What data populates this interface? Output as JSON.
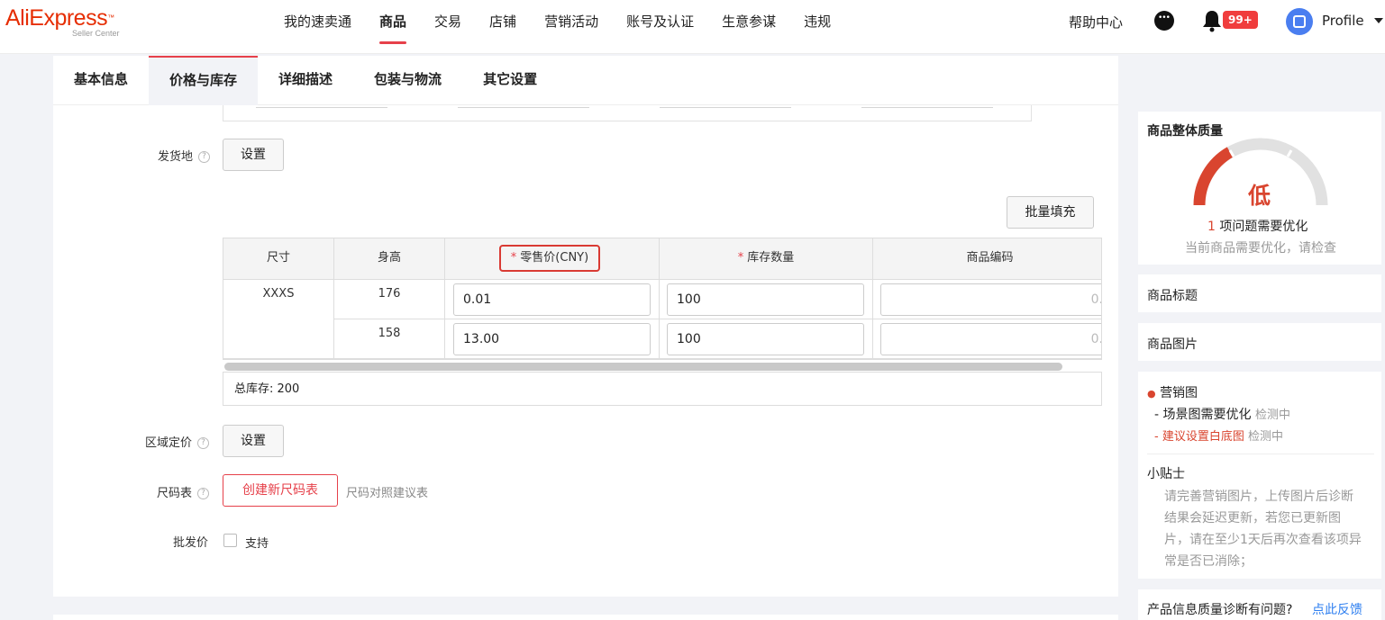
{
  "header": {
    "logo_text": "AliExpress",
    "logo_sub": "Seller Center",
    "nav": [
      {
        "label": "我的速卖通"
      },
      {
        "label": "商品"
      },
      {
        "label": "交易"
      },
      {
        "label": "店铺"
      },
      {
        "label": "营销活动"
      },
      {
        "label": "账号及认证"
      },
      {
        "label": "生意参谋"
      },
      {
        "label": "违规"
      }
    ],
    "help": "帮助中心",
    "notif_badge": "99+",
    "profile": "Profile"
  },
  "tabs": [
    {
      "label": "基本信息"
    },
    {
      "label": "价格与库存"
    },
    {
      "label": "详细描述"
    },
    {
      "label": "包装与物流"
    },
    {
      "label": "其它设置"
    }
  ],
  "form": {
    "ship_from_label": "发货地",
    "ship_from_button": "设置",
    "bulk_fill": "批量填充",
    "table": {
      "headers": [
        "尺寸",
        "身高",
        "零售价(CNY)",
        "库存数量",
        "商品编码"
      ],
      "rows": [
        {
          "size": "XXXS",
          "height": "176",
          "price": "0.01",
          "stock": "100",
          "code_hint": "0."
        },
        {
          "size": "",
          "height": "158",
          "price": "13.00",
          "stock": "100",
          "code_hint": "0."
        }
      ],
      "total": "总库存: 200"
    },
    "region_price_label": "区域定价",
    "region_price_button": "设置",
    "size_chart_label": "尺码表",
    "size_chart_button": "创建新尺码表",
    "size_chart_link": "尺码对照建议表",
    "wholesale_label": "批发价",
    "wholesale_option": "支持"
  },
  "sidebar": {
    "quality_title": "商品整体质量",
    "quality_level": "低",
    "issue_count": "1",
    "issue_text": "项问题需要优化",
    "quality_hint": "当前商品需要优化，请检查",
    "title_card": "商品标题",
    "image_card": "商品图片",
    "marketing": {
      "title": "营销图",
      "item1": "- 场景图需要优化",
      "item1_status": "检测中",
      "item2": "- 建议设置白底图",
      "item2_status": "检测中"
    },
    "tips_title": "小贴士",
    "tips_lines": [
      "请完善营销图片，上传图片后诊断",
      "结果会延迟更新，若您已更新图",
      "片，请在至少1天后再次查看该项异",
      "常是否已消除；"
    ],
    "feedback_q": "产品信息质量诊断有问题?",
    "feedback_link": "点此反馈"
  },
  "colors": {
    "brand": "#e62e04",
    "accent": "#e6404a",
    "gauge_low": "#d9452f",
    "link_blue": "#2e7ff0"
  }
}
